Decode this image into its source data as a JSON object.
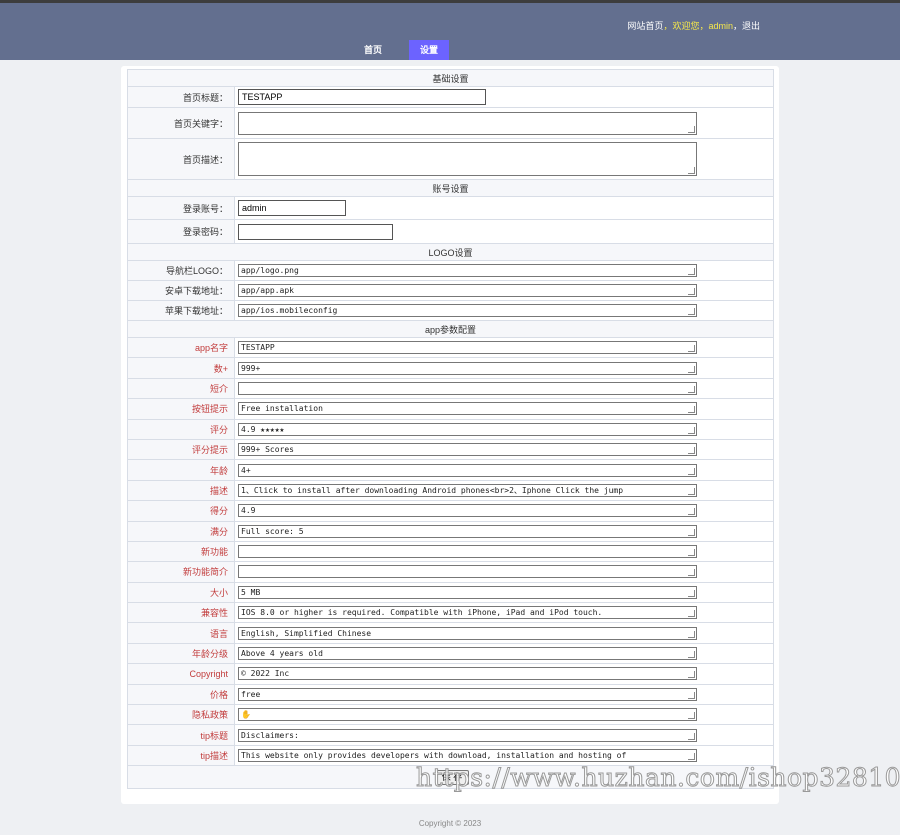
{
  "topbar": {
    "site_home": "网站首页",
    "sep1": "，",
    "welcome": "欢迎您，",
    "user": "admin",
    "sep2": "，",
    "logout": "退出"
  },
  "nav": {
    "home": "首页",
    "settings": "设置"
  },
  "sections": {
    "basic": "基础设置",
    "account": "账号设置",
    "logo": "LOGO设置",
    "app": "app参数配置"
  },
  "basic": {
    "title_label": "首页标题：",
    "title_value": "TESTAPP",
    "keywords_label": "首页关键字：",
    "keywords_value": "",
    "desc_label": "首页描述：",
    "desc_value": ""
  },
  "account": {
    "login_label": "登录账号：",
    "login_value": "admin",
    "password_label": "登录密码：",
    "password_value": ""
  },
  "logo": {
    "nav_logo_label": "导航栏LOGO：",
    "nav_logo_value": "app/logo.png",
    "android_label": "安卓下载地址：",
    "android_value": "app/app.apk",
    "ios_label": "苹果下载地址：",
    "ios_value": "app/ios.mobileconfig"
  },
  "app_params": [
    {
      "label": "app名字",
      "value": "TESTAPP"
    },
    {
      "label": "数+",
      "value": "999+"
    },
    {
      "label": "短介",
      "value": ""
    },
    {
      "label": "按钮提示",
      "value": "Free installation"
    },
    {
      "label": "评分",
      "value": "4.9 ★★★★★"
    },
    {
      "label": "评分提示",
      "value": "999+ Scores"
    },
    {
      "label": "年龄",
      "value": "4+"
    },
    {
      "label": "描述",
      "value": "1、Click to install after downloading Android phones<br>2、Iphone Click the jump"
    },
    {
      "label": "得分",
      "value": "4.9"
    },
    {
      "label": "满分",
      "value": "Full score: 5"
    },
    {
      "label": "新功能",
      "value": ""
    },
    {
      "label": "新功能简介",
      "value": ""
    },
    {
      "label": "大小",
      "value": "5 MB"
    },
    {
      "label": "兼容性",
      "value": "IOS 8.0 or higher is required. Compatible with iPhone, iPad and iPod touch."
    },
    {
      "label": "语言",
      "value": "English, Simplified Chinese"
    },
    {
      "label": "年龄分级",
      "value": "Above 4 years old"
    },
    {
      "label": "Copyright",
      "value": "© 2022 Inc"
    },
    {
      "label": "价格",
      "value": "free"
    },
    {
      "label": "隐私政策",
      "value": "✋"
    },
    {
      "label": "tip标题",
      "value": "Disclaimers:"
    },
    {
      "label": "tip描述",
      "value": "This website only provides developers with download, installation and hosting of"
    }
  ],
  "save_label": "保 存",
  "footer": "Copyright © 2023",
  "watermark": "https://www.huzhan.com/ishop32810",
  "colors": {
    "topbar": "#636f8f",
    "nav_active": "#6c63ff",
    "accent_text": "#f6e84b"
  }
}
